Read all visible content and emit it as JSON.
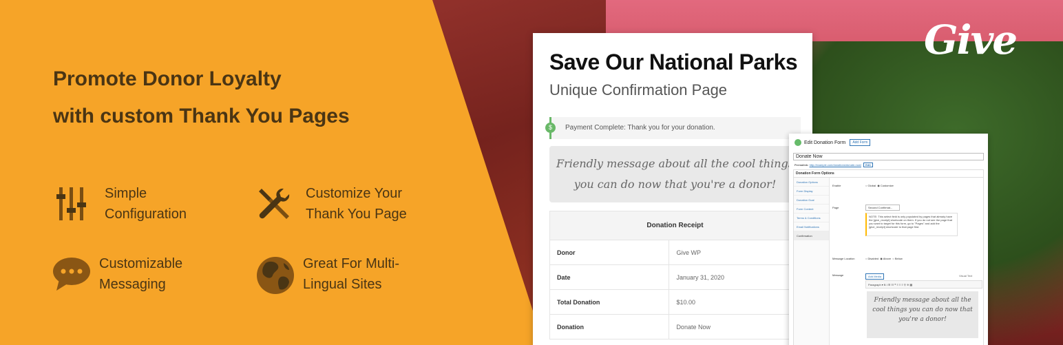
{
  "brand": {
    "logo_text": "Give",
    "accent": "#f6a428",
    "text_color": "#4a3514"
  },
  "headline": {
    "line1": "Promote Donor Loyalty",
    "line2": "with custom Thank You Pages"
  },
  "features": [
    {
      "icon": "sliders-icon",
      "line1": "Simple",
      "line2": "Configuration"
    },
    {
      "icon": "wrench-screwdriver-icon",
      "line1": "Customize Your",
      "line2": "Thank You Page"
    },
    {
      "icon": "chat-bubble-icon",
      "line1": "Customizable",
      "line2": "Messaging"
    },
    {
      "icon": "globe-icon",
      "line1": "Great For Multi-",
      "line2": "Lingual Sites"
    }
  ],
  "card": {
    "title": "Save Our National Parks",
    "subtitle": "Unique Confirmation Page",
    "notice": "Payment Complete: Thank you for your donation.",
    "message_line1": "Friendly message about all the cool things",
    "message_line2": "you can do now that you're a donor!",
    "receipt": {
      "header": "Donation Receipt",
      "rows": [
        {
          "label": "Donor",
          "value": "Give WP"
        },
        {
          "label": "Date",
          "value": "January 31, 2020"
        },
        {
          "label": "Total Donation",
          "value": "$10.00"
        },
        {
          "label": "Donation",
          "value": "Donate Now"
        }
      ]
    }
  },
  "admin": {
    "heading": "Edit Donation Form",
    "add_form": "Add Form",
    "form_title": "Donate Now",
    "permalink_label": "Permalink:",
    "permalink_url": "http://example.com/donations/donate-now/",
    "edit": "Edit",
    "options_header": "Donation Form Options",
    "tabs": [
      "Donation Options",
      "Form Display",
      "Donation Goal",
      "Form Content",
      "Terms & Conditions",
      "Email Notifications",
      "Confirmation"
    ],
    "enable_label": "Enable",
    "enable_global": "Global",
    "enable_customize": "Customize",
    "page_label": "Page",
    "page_value": "Second Confirmat...",
    "note": "NOTE: This select field is only populated by pages that already have the [give_receipt] shortcode on them. If you do not see the page that you want to target for this form, go to \"Pages\" and add the [give_receipt] shortcode to that page first.",
    "location_label": "Message Location",
    "location_options": [
      "Disabled",
      "Above",
      "Below"
    ],
    "message_label": "Message",
    "add_media": "Add Media",
    "visual_text": "Visual   Text",
    "toolbar": "Paragraph  ▾   B  I  ☰  ☷  ❝  ≡  ≡  ≡  ⚲  ≋  ▦",
    "editor_text": "Friendly message about all the cool things you can do now that you're a donor!"
  }
}
